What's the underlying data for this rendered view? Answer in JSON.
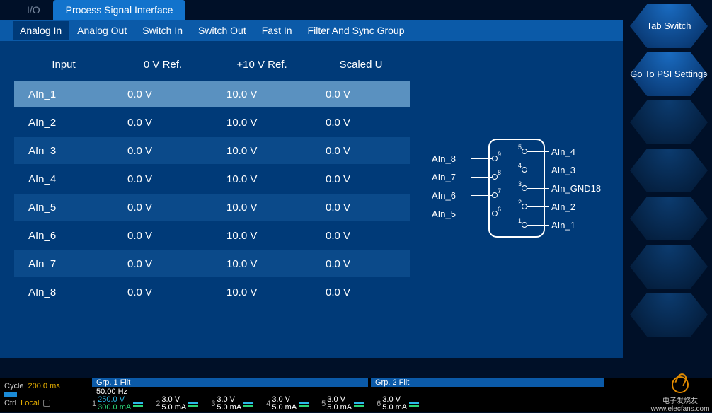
{
  "breadcrumb": "I/O",
  "main_tab": "Process Signal Interface",
  "sub_tabs": [
    "Analog In",
    "Analog Out",
    "Switch In",
    "Switch Out",
    "Fast In",
    "Filter And Sync Group"
  ],
  "sub_tab_active_index": 0,
  "table": {
    "headers": [
      "Input",
      "0 V Ref.",
      "+10 V Ref.",
      "Scaled U"
    ],
    "rows": [
      {
        "input": "AIn_1",
        "ref0": "0.0 V",
        "ref10": "10.0 V",
        "scaled": "0.0 V",
        "selected": true
      },
      {
        "input": "AIn_2",
        "ref0": "0.0 V",
        "ref10": "10.0 V",
        "scaled": "0.0 V"
      },
      {
        "input": "AIn_3",
        "ref0": "0.0 V",
        "ref10": "10.0 V",
        "scaled": "0.0 V"
      },
      {
        "input": "AIn_4",
        "ref0": "0.0 V",
        "ref10": "10.0 V",
        "scaled": "0.0 V"
      },
      {
        "input": "AIn_5",
        "ref0": "0.0 V",
        "ref10": "10.0 V",
        "scaled": "0.0 V"
      },
      {
        "input": "AIn_6",
        "ref0": "0.0 V",
        "ref10": "10.0 V",
        "scaled": "0.0 V"
      },
      {
        "input": "AIn_7",
        "ref0": "0.0 V",
        "ref10": "10.0 V",
        "scaled": "0.0 V"
      },
      {
        "input": "AIn_8",
        "ref0": "0.0 V",
        "ref10": "10.0 V",
        "scaled": "0.0 V"
      }
    ]
  },
  "connector": {
    "left_pins": [
      {
        "label": "AIn_8",
        "num": "9"
      },
      {
        "label": "AIn_7",
        "num": "8"
      },
      {
        "label": "AIn_6",
        "num": "7"
      },
      {
        "label": "AIn_5",
        "num": "6"
      }
    ],
    "right_pins": [
      {
        "label": "AIn_4",
        "num": "5"
      },
      {
        "label": "AIn_3",
        "num": "4"
      },
      {
        "label": "AIn_GND18",
        "num": "3"
      },
      {
        "label": "AIn_2",
        "num": "2"
      },
      {
        "label": "AIn_1",
        "num": "1"
      }
    ]
  },
  "hex_buttons": [
    {
      "label": "Tab Switch",
      "empty": false
    },
    {
      "label": "Go To PSI Settings",
      "empty": false
    },
    {
      "label": "",
      "empty": true
    },
    {
      "label": "",
      "empty": true
    },
    {
      "label": "",
      "empty": true
    },
    {
      "label": "",
      "empty": true
    },
    {
      "label": "",
      "empty": true
    }
  ],
  "status": {
    "cycle_label": "Cycle",
    "cycle_value": "200.0 ms",
    "ctrl_label": "Ctrl",
    "ctrl_value": "Local",
    "group1": "Grp. 1 Filt",
    "group2": "Grp. 2 Filt",
    "freq": "50.00   Hz",
    "channels": [
      {
        "n": "1",
        "top": "250.0 V",
        "bot": "300.0 mA",
        "top_color": "cyanv",
        "bot_color": "greenv"
      },
      {
        "n": "2",
        "top": "3.0 V",
        "bot": "5.0 mA",
        "top_color": "whitev",
        "bot_color": "whitev"
      },
      {
        "n": "3",
        "top": "3.0 V",
        "bot": "5.0 mA",
        "top_color": "whitev",
        "bot_color": "whitev"
      },
      {
        "n": "4",
        "top": "3.0 V",
        "bot": "5.0 mA",
        "top_color": "whitev",
        "bot_color": "whitev"
      },
      {
        "n": "5",
        "top": "3.0 V",
        "bot": "5.0 mA",
        "top_color": "whitev",
        "bot_color": "whitev"
      },
      {
        "n": "6",
        "top": "3.0 V",
        "bot": "5.0 mA",
        "top_color": "whitev",
        "bot_color": "whitev"
      }
    ],
    "logo_top": "电子发烧友",
    "logo_bottom": "www.elecfans.com"
  }
}
